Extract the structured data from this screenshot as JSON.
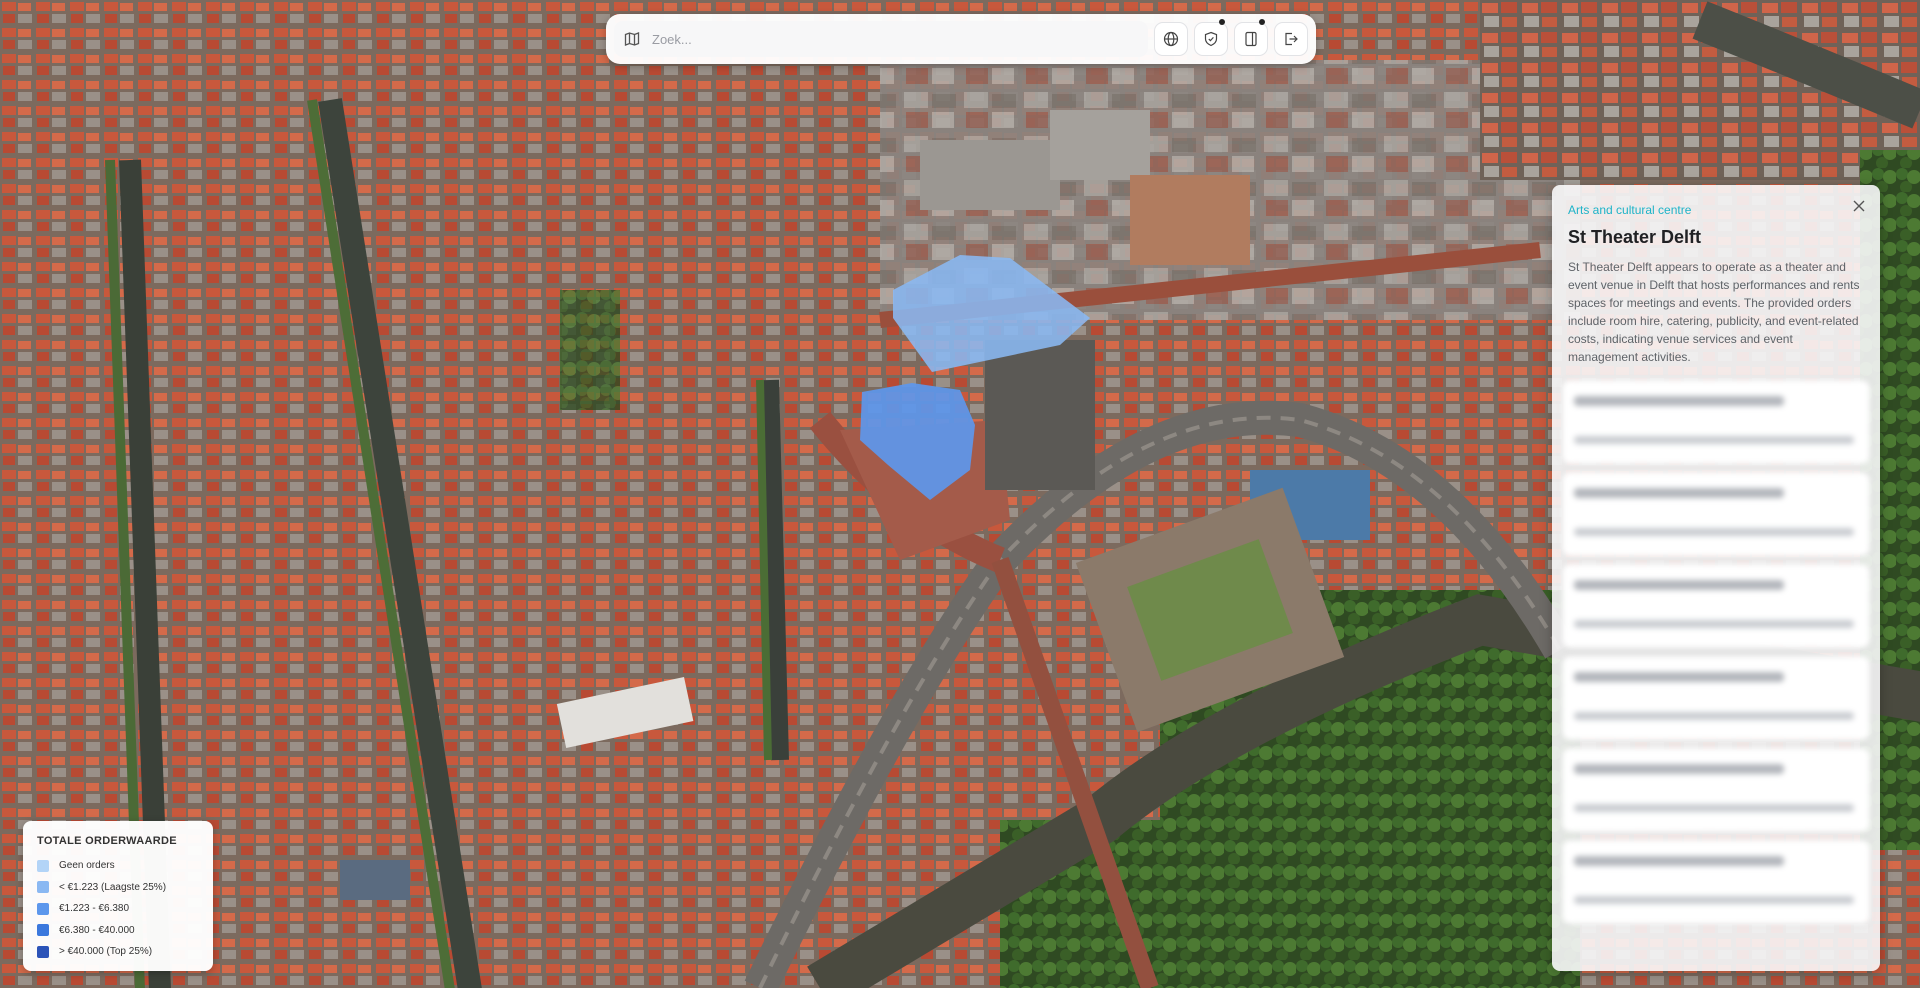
{
  "search": {
    "placeholder": "Zoek..."
  },
  "toolbar": {
    "buttons": [
      {
        "icon": "globe-icon",
        "has_dot": false
      },
      {
        "icon": "shield-icon",
        "has_dot": true
      },
      {
        "icon": "panel-icon",
        "has_dot": true
      },
      {
        "icon": "logout-icon",
        "has_dot": false
      }
    ]
  },
  "info_panel": {
    "category": "Arts and cultural centre",
    "title": "St Theater Delft",
    "description": "St Theater Delft appears to operate as a theater and event venue in Delft that hosts performances and rents spaces for meetings and events. The provided orders include room hire, catering, publicity, and event-related costs, indicating venue services and event management activities.",
    "close_icon": "close-icon",
    "order_cards_count_visible": 6
  },
  "legend": {
    "title": "TOTALE ORDERWAARDE",
    "items": [
      {
        "label": "Geen orders",
        "color": "#b3d4f7"
      },
      {
        "label": "< €1.223 (Laagste 25%)",
        "color": "#8ab8f2"
      },
      {
        "label": "€1.223 - €6.380",
        "color": "#5d97ec"
      },
      {
        "label": "€6.380 - €40.000",
        "color": "#3b78dd"
      },
      {
        "label": "> €40.000 (Top 25%)",
        "color": "#2c53b8"
      }
    ]
  },
  "colors": {
    "accent": "#1eb3c8",
    "highlight_building_light": "#8ab8f2",
    "highlight_building_strong": "#5d97ec"
  }
}
